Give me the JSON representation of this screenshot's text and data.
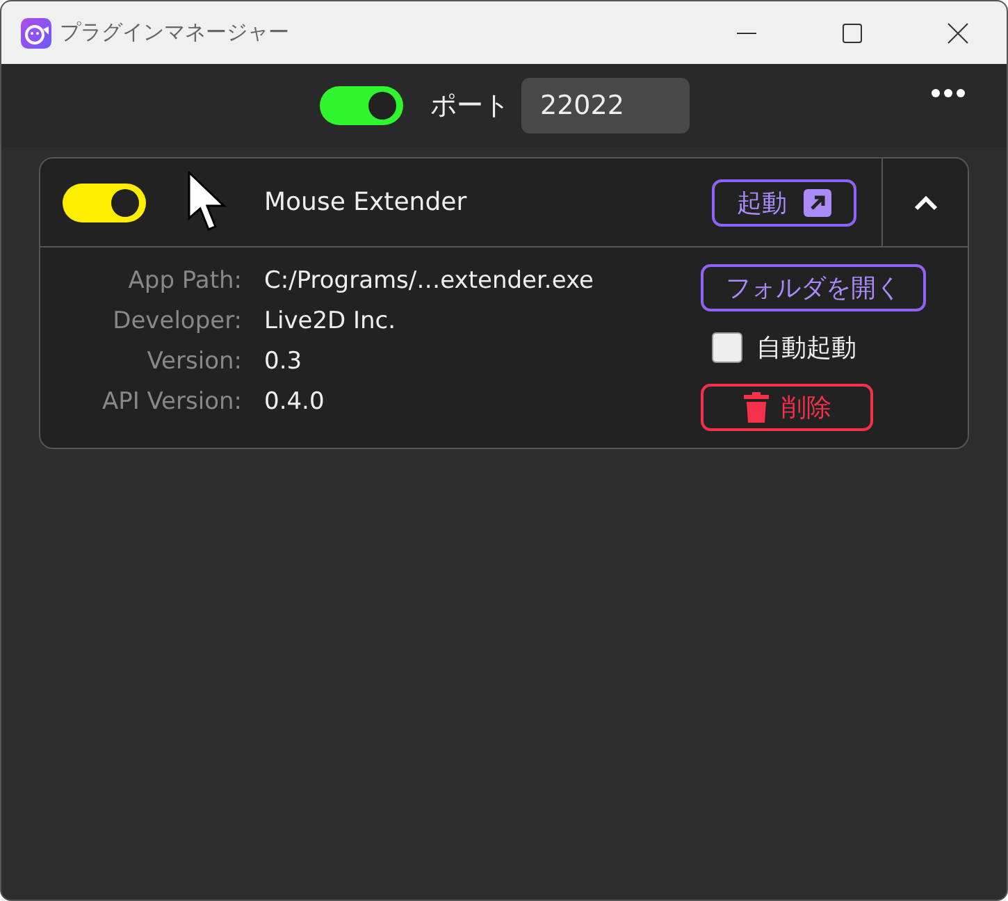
{
  "window": {
    "title": "プラグインマネージャー"
  },
  "toolbar": {
    "server_toggle": {
      "on": true,
      "color": "#2ef52e"
    },
    "port_label": "ポート",
    "port_value": "22022"
  },
  "plugins": [
    {
      "enabled": true,
      "color": "#ffee00",
      "name": "Mouse Extender",
      "start_button": "起動",
      "expanded": true,
      "details": [
        {
          "label": "App Path:",
          "value": "C:/Programs/…extender.exe"
        },
        {
          "label": "Developer:",
          "value": "Live2D Inc."
        },
        {
          "label": "Version:",
          "value": "0.3"
        },
        {
          "label": "API Version:",
          "value": "0.4.0"
        }
      ],
      "open_folder_button": "フォルダを開く",
      "autostart": {
        "label": "自動起動",
        "checked": false
      },
      "delete_button": "削除"
    }
  ]
}
